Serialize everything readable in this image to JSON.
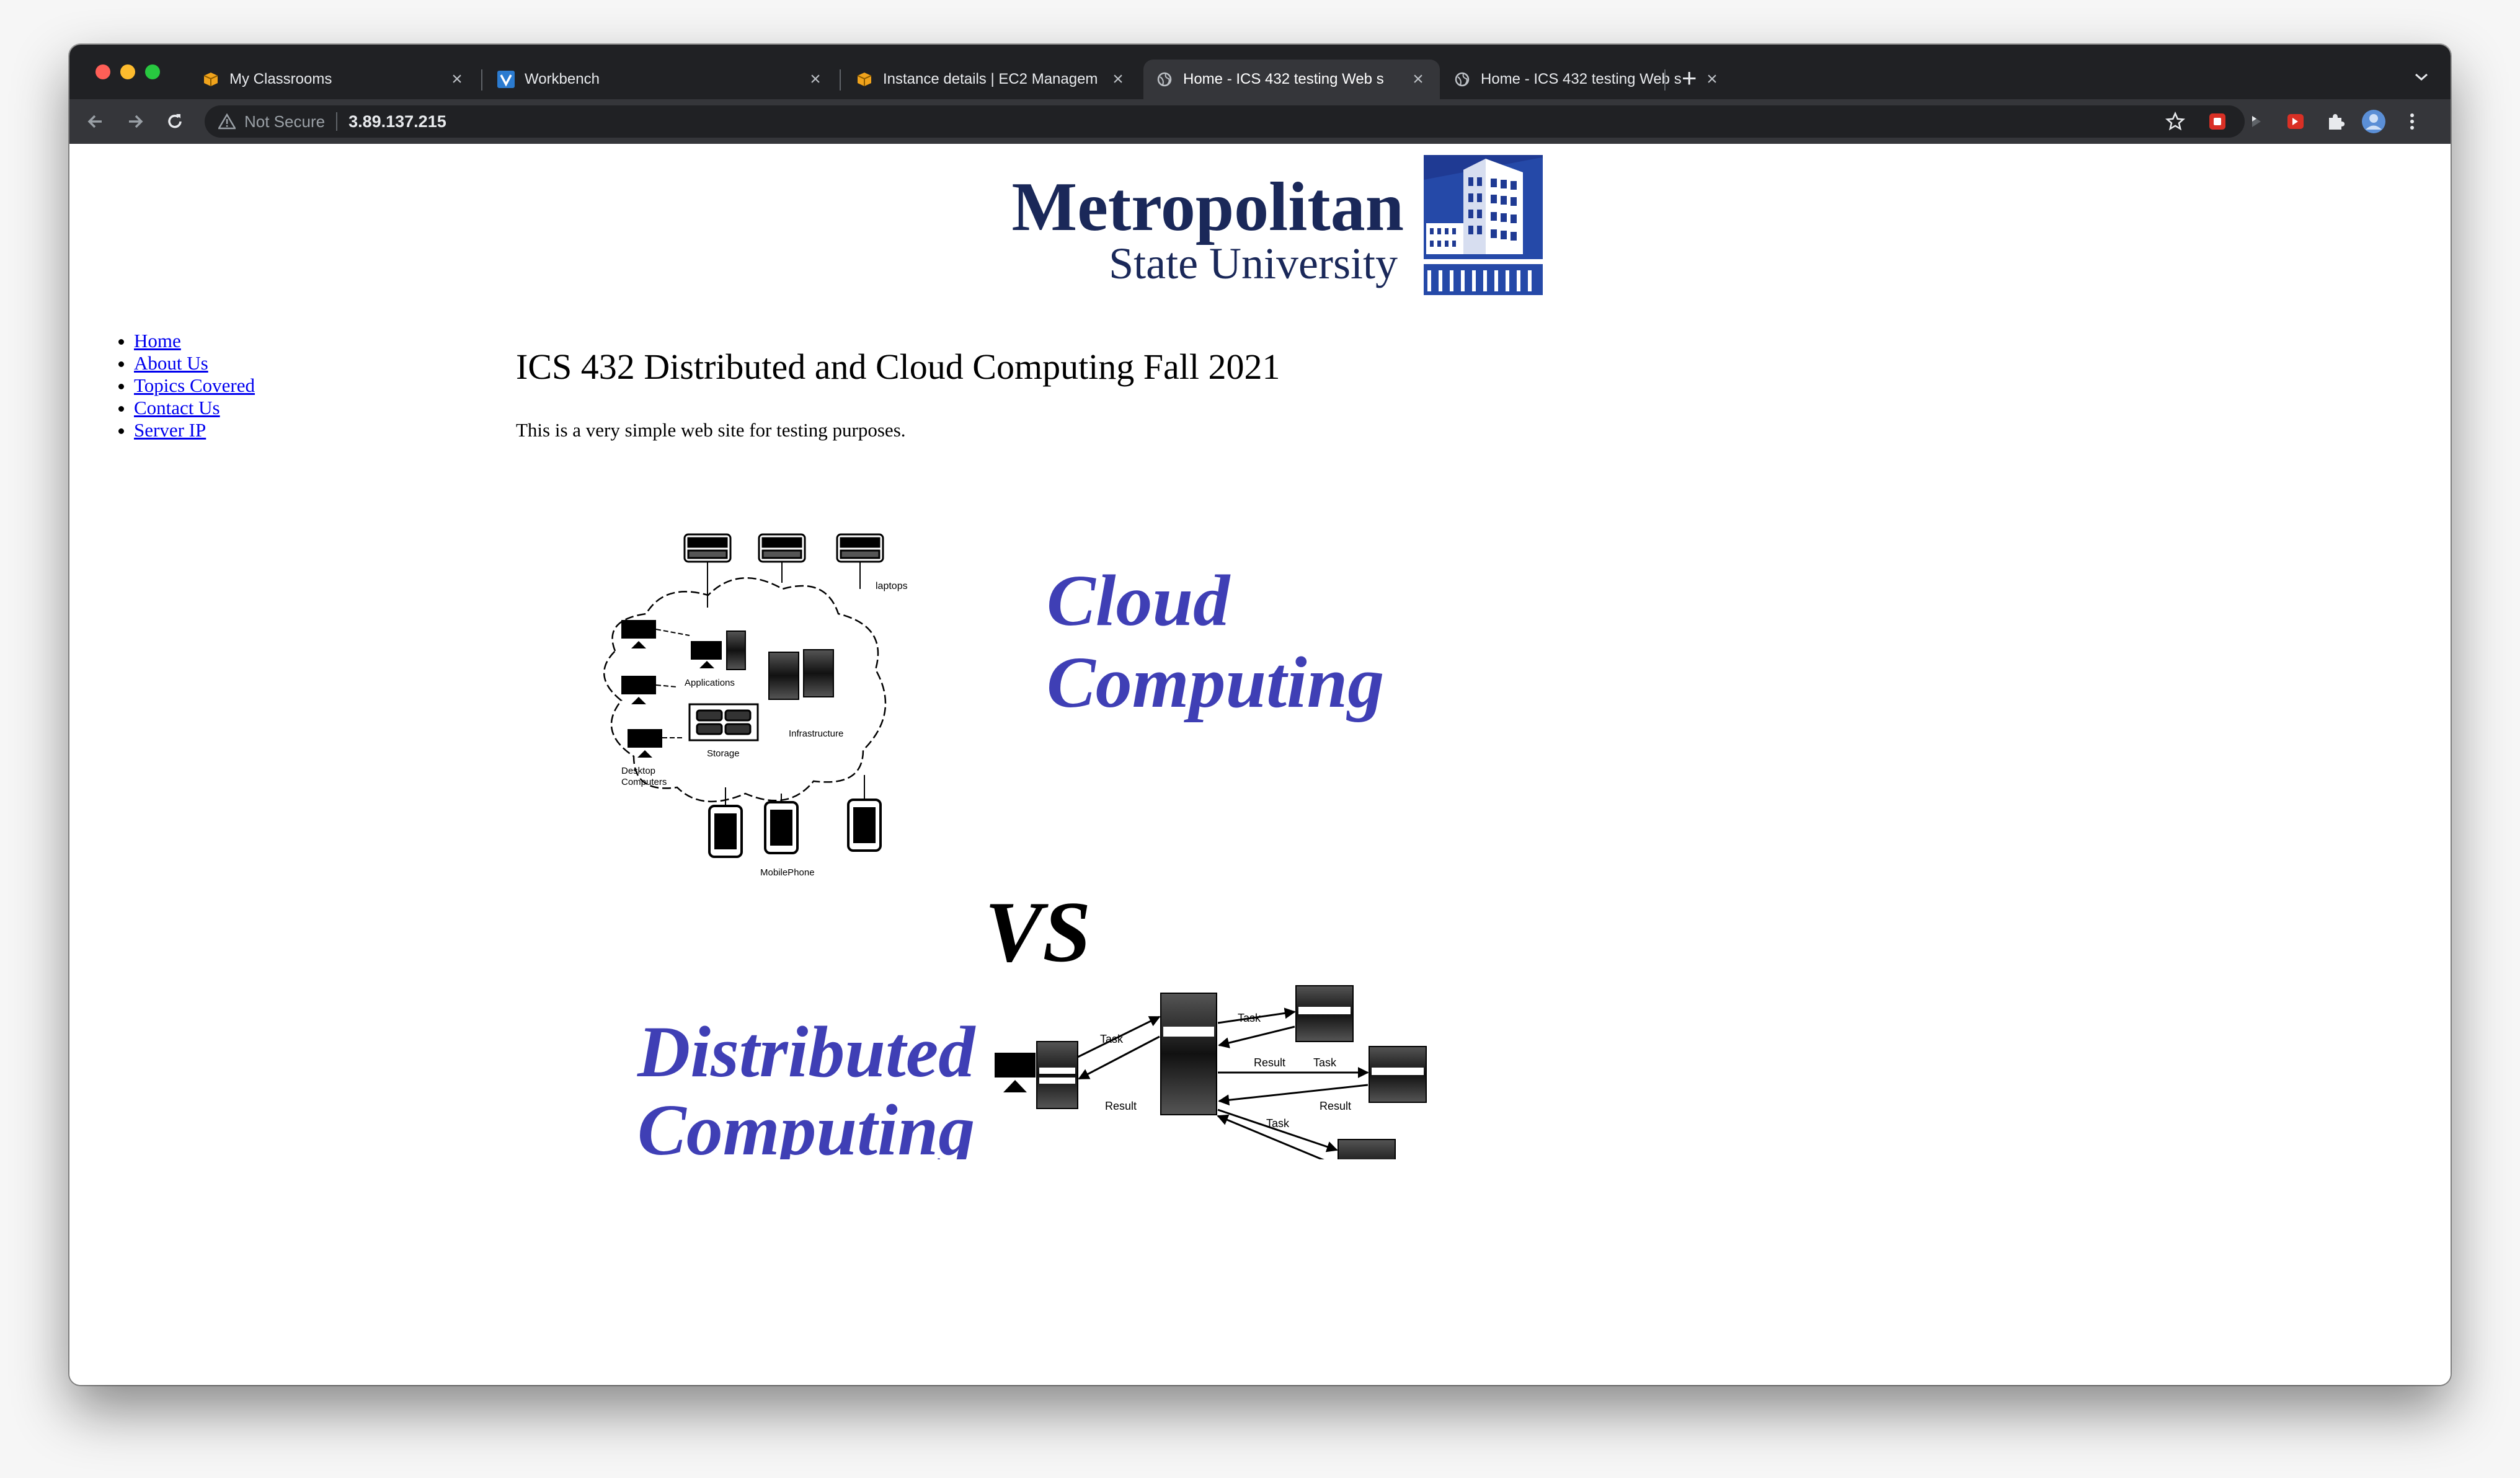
{
  "browser": {
    "tabs": [
      {
        "title": "My Classrooms",
        "favicon": "aws-box-icon",
        "active": false
      },
      {
        "title": "Workbench",
        "favicon": "vocareum-v-icon",
        "active": false
      },
      {
        "title": "Instance details | EC2 Managem",
        "favicon": "aws-box-icon",
        "active": false
      },
      {
        "title": "Home - ICS 432 testing Web s",
        "favicon": "globe-icon",
        "active": true
      },
      {
        "title": "Home - ICS 432 testing Web s",
        "favicon": "globe-icon",
        "active": false
      }
    ],
    "new_tab_label": "+",
    "security_label": "Not Secure",
    "url": "3.89.137.215"
  },
  "logo": {
    "line1": "Metropolitan",
    "line2": "State University"
  },
  "nav": {
    "items": [
      {
        "label": "Home"
      },
      {
        "label": "About Us"
      },
      {
        "label": "Topics Covered"
      },
      {
        "label": "Contact Us"
      },
      {
        "label": "Server IP"
      }
    ]
  },
  "main": {
    "heading": "ICS 432 Distributed and Cloud Computing Fall 2021",
    "description": "This is a very simple web site for testing purposes."
  },
  "figure": {
    "cloud_title_1": "Cloud",
    "cloud_title_2": "Computing",
    "vs": "VS",
    "dist_title_1": "Distributed",
    "dist_title_2": "Computing",
    "labels": {
      "laptops": "laptops",
      "applications": "Applications",
      "infrastructure": "Infrastructure",
      "storage": "Storage",
      "desktop_1": "Desktop",
      "desktop_2": "Computers",
      "mobile": "MobilePhone",
      "task": "Task",
      "result": "Result"
    },
    "accent_color": "#3f3fb5"
  }
}
